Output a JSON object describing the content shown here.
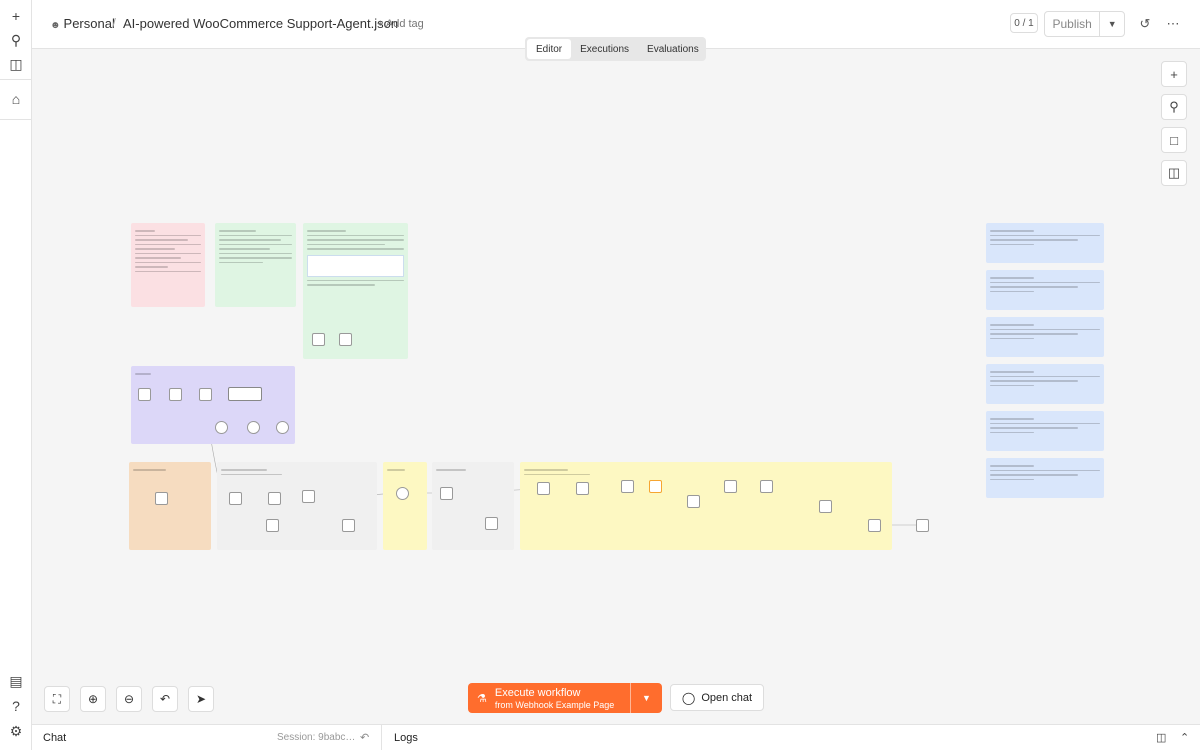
{
  "header": {
    "project": "Personal",
    "separator": "/",
    "workflow_name": "AI-powered WooCommerce Support-Agent.json",
    "add_tag": "+ Add tag",
    "counter": "0 / 1",
    "publish_label": "Publish"
  },
  "tabs": [
    {
      "label": "Editor",
      "active": true
    },
    {
      "label": "Executions",
      "active": false
    },
    {
      "label": "Evaluations",
      "active": false
    }
  ],
  "execute": {
    "label": "Execute workflow",
    "sublabel": "from Webhook Example Page"
  },
  "open_chat": "Open chat",
  "bottom": {
    "chat": "Chat",
    "session": "Session: 9babc…",
    "logs": "Logs"
  },
  "colors": {
    "accent": "#ff6d2d",
    "note_pink": "#fbe0e3",
    "note_green": "#dff5e3",
    "note_purple": "#dcd7f8",
    "note_orange": "#f6dcc0",
    "note_yellow": "#fdf8c2",
    "note_blue": "#d9e6fb"
  },
  "icons": {
    "rail": [
      "plus-icon",
      "search-icon",
      "panel-icon",
      "home-icon",
      "insights-icon",
      "help-icon",
      "settings-icon"
    ],
    "header": [
      "history-icon",
      "more-icon"
    ],
    "canvas_tools": [
      "plus-icon",
      "search-icon",
      "sticky-note-icon",
      "panel-icon"
    ],
    "controls": [
      "fit-view-icon",
      "zoom-in-icon",
      "zoom-out-icon",
      "undo-icon",
      "cursor-icon"
    ]
  }
}
